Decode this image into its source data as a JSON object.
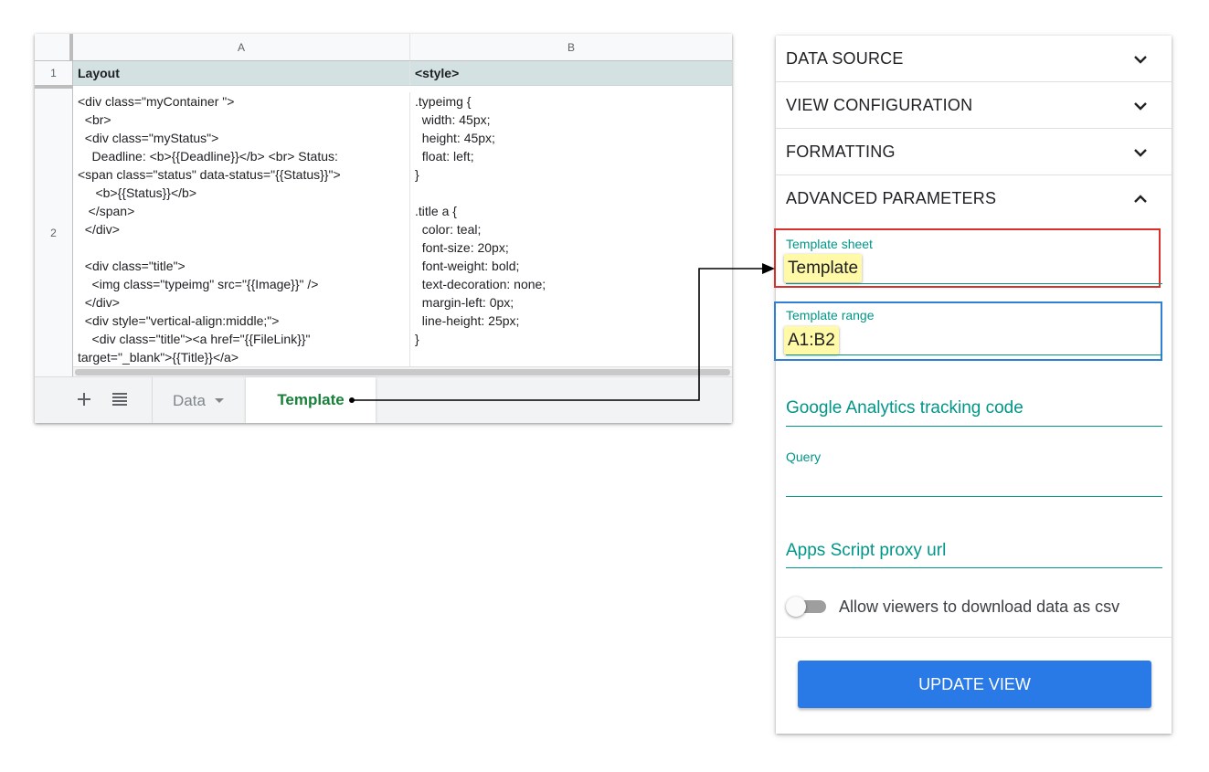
{
  "spreadsheet": {
    "columns": [
      "A",
      "B"
    ],
    "rows": [
      "1",
      "2"
    ],
    "header_cells": [
      "Layout",
      "<style>"
    ],
    "cell_a2": "<div class=\"myContainer \">\n  <br>\n  <div class=\"myStatus\">\n    Deadline: <b>{{Deadline}}</b> <br> Status:\n<span class=\"status\" data-status=\"{{Status}}\">\n     <b>{{Status}}</b>\n   </span>\n  </div>\n\n  <div class=\"title\">\n    <img class=\"typeimg\" src=\"{{Image}}\" />\n  </div>\n  <div style=\"vertical-align:middle;\">\n    <div class=\"title\"><a href=\"{{FileLink}}\"\ntarget=\"_blank\">{{Title}}</a>",
    "cell_b2": ".typeimg {\n  width: 45px;\n  height: 45px;\n  float: left;\n}\n\n.title a {\n  color: teal;\n  font-size: 20px;\n  font-weight: bold;\n  text-decoration: none;\n  margin-left: 0px;\n  line-height: 25px;\n}",
    "tabs": {
      "add_icon": "plus-icon",
      "menu_icon": "list-icon",
      "data_tab": "Data",
      "template_tab": "Template"
    }
  },
  "panel": {
    "sections": [
      {
        "label": "DATA SOURCE",
        "state": "collapsed"
      },
      {
        "label": "VIEW CONFIGURATION",
        "state": "collapsed"
      },
      {
        "label": "FORMATTING",
        "state": "collapsed"
      },
      {
        "label": "ADVANCED PARAMETERS",
        "state": "expanded"
      }
    ],
    "template_sheet": {
      "label": "Template sheet",
      "value": "Template"
    },
    "template_range": {
      "label": "Template range",
      "value": "A1:B2"
    },
    "ga_tracking": {
      "label": "Google Analytics tracking code"
    },
    "query": {
      "label": "Query"
    },
    "proxy_url": {
      "label": "Apps Script proxy url"
    },
    "csv_toggle": {
      "label": "Allow viewers to download data as csv",
      "on": false
    },
    "update_button": "UPDATE VIEW"
  },
  "colors": {
    "accent_teal": "#009688",
    "header_row_bg": "#d3e1e3",
    "template_tab_green": "#188038",
    "highlight_yellow": "#fff9a8",
    "callout_red": "#d9302c",
    "callout_blue": "#2f7fd6",
    "button_blue": "#2979e6"
  }
}
